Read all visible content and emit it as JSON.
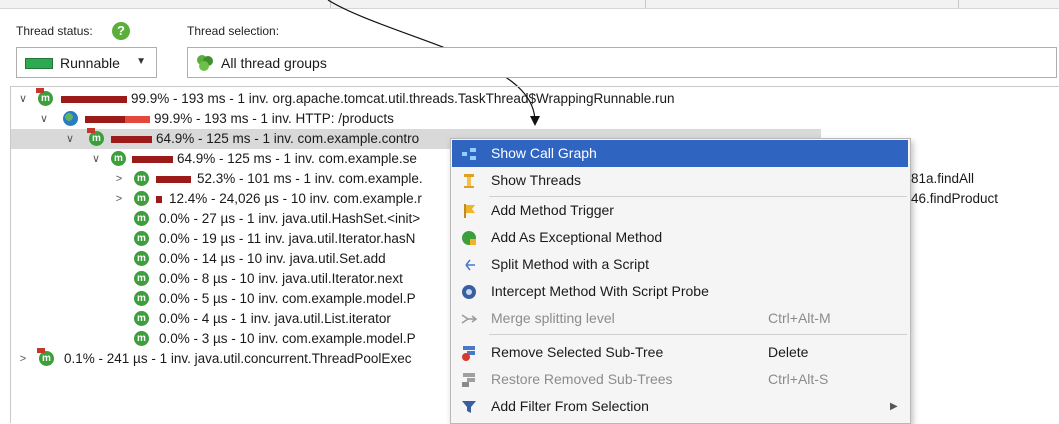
{
  "toolbar": {
    "thread_status_label": "Thread status:",
    "thread_status_value": "Runnable",
    "thread_selection_label": "Thread selection:",
    "thread_selection_value": "All thread groups",
    "help_icon": "question-icon"
  },
  "colors": {
    "runnable": "#2fa84f",
    "bar_dark": "#9b1b1b",
    "bar_light": "#e4483d",
    "menu_highlight": "#2f64c1",
    "method_icon": "#3c9f3c"
  },
  "tree": {
    "rows": [
      {
        "text": "99.9% - 193 ms - 1 inv. org.apache.tomcat.util.threads.TaskThread$WrappingRunnable.run",
        "percent": 99.9
      },
      {
        "text": "99.9% - 193 ms - 1 inv. HTTP: /products",
        "percent": 99.9
      },
      {
        "text": "64.9% - 125 ms - 1 inv. com.example.contro",
        "percent": 64.9
      },
      {
        "text": "64.9% - 125 ms - 1 inv. com.example.se",
        "percent": 64.9
      },
      {
        "text": "52.3% - 101 ms - 1 inv. com.example.",
        "tail": "81a.findAll",
        "percent": 52.3
      },
      {
        "text": "12.4% - 24,026 µs - 10 inv. com.example.r",
        "tail": "46.findProduct",
        "percent": 12.4
      },
      {
        "text": "0.0% - 27 µs - 1 inv. java.util.HashSet.<init>",
        "percent": 0.0
      },
      {
        "text": "0.0% - 19 µs - 11 inv. java.util.Iterator.hasN",
        "percent": 0.0
      },
      {
        "text": "0.0% - 14 µs - 10 inv. java.util.Set.add",
        "percent": 0.0
      },
      {
        "text": "0.0% - 8 µs - 10 inv. java.util.Iterator.next",
        "percent": 0.0
      },
      {
        "text": "0.0% - 5 µs - 10 inv. com.example.model.P",
        "percent": 0.0
      },
      {
        "text": "0.0% - 4 µs - 1 inv. java.util.List.iterator",
        "percent": 0.0
      },
      {
        "text": "0.0% - 3 µs - 10 inv. com.example.model.P",
        "percent": 0.0
      },
      {
        "text": "0.1% - 241 µs - 1 inv. java.util.concurrent.ThreadPoolExec",
        "percent": 0.1
      }
    ]
  },
  "context_menu": {
    "items": [
      {
        "label": "Show Call Graph",
        "shortcut": "",
        "icon": "call-graph-icon"
      },
      {
        "label": "Show Threads",
        "shortcut": "",
        "icon": "threads-icon"
      },
      {
        "label": "Add Method Trigger",
        "shortcut": "",
        "icon": "flag-icon"
      },
      {
        "label": "Add As Exceptional Method",
        "shortcut": "",
        "icon": "exceptional-method-icon"
      },
      {
        "label": "Split Method with a Script",
        "shortcut": "",
        "icon": "split-icon"
      },
      {
        "label": "Intercept Method With Script Probe",
        "shortcut": "",
        "icon": "probe-icon"
      },
      {
        "label": "Merge splitting level",
        "shortcut": "Ctrl+Alt-M",
        "icon": "merge-icon"
      },
      {
        "label": "Remove Selected Sub-Tree",
        "shortcut": "Delete",
        "icon": "remove-subtree-icon"
      },
      {
        "label": "Restore Removed Sub-Trees",
        "shortcut": "Ctrl+Alt-S",
        "icon": "restore-icon"
      },
      {
        "label": "Add Filter From Selection",
        "shortcut": "",
        "icon": "filter-icon"
      }
    ]
  }
}
